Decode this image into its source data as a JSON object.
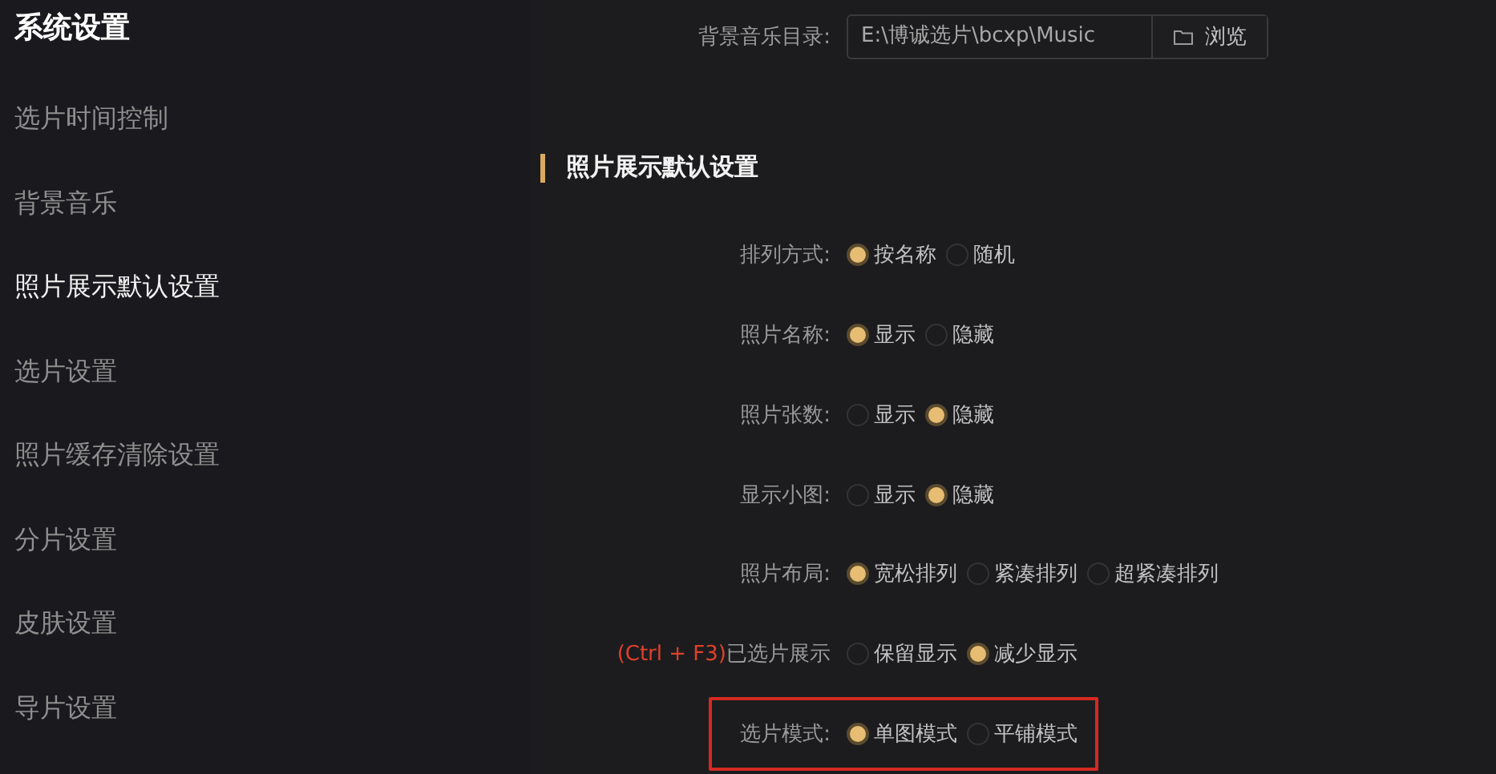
{
  "sidebar": {
    "title": "系统设置",
    "items": [
      {
        "label": "选片时间控制",
        "selected": false
      },
      {
        "label": "背景音乐",
        "selected": false
      },
      {
        "label": "照片展示默认设置",
        "selected": true
      },
      {
        "label": "选片设置",
        "selected": false
      },
      {
        "label": "照片缓存清除设置",
        "selected": false
      },
      {
        "label": "分片设置",
        "selected": false
      },
      {
        "label": "皮肤设置",
        "selected": false
      },
      {
        "label": "导片设置",
        "selected": false
      }
    ]
  },
  "music_dir": {
    "label": "背景音乐目录:",
    "value": "E:\\博诚选片\\bcxp\\Music",
    "button": "浏览"
  },
  "section": {
    "title": "照片展示默认设置",
    "rows": [
      {
        "label": "排列方式:",
        "options": [
          {
            "label": "按名称",
            "selected": true
          },
          {
            "label": "随机",
            "selected": false
          }
        ]
      },
      {
        "label": "照片名称:",
        "options": [
          {
            "label": "显示",
            "selected": true
          },
          {
            "label": "隐藏",
            "selected": false
          }
        ]
      },
      {
        "label": "照片张数:",
        "options": [
          {
            "label": "显示",
            "selected": false
          },
          {
            "label": "隐藏",
            "selected": true
          }
        ]
      },
      {
        "label": "显示小图:",
        "options": [
          {
            "label": "显示",
            "selected": false
          },
          {
            "label": "隐藏",
            "selected": true
          }
        ]
      },
      {
        "label": "照片布局:",
        "options": [
          {
            "label": "宽松排列",
            "selected": true
          },
          {
            "label": "紧凑排列",
            "selected": false
          },
          {
            "label": "超紧凑排列",
            "selected": false
          }
        ]
      },
      {
        "hotkey": "(Ctrl + F3)",
        "label": "已选片展示",
        "options": [
          {
            "label": "保留显示",
            "selected": false
          },
          {
            "label": "减少显示",
            "selected": true
          }
        ]
      },
      {
        "label": "选片模式:",
        "highlighted": true,
        "options": [
          {
            "label": "单图模式",
            "selected": true
          },
          {
            "label": "平铺模式",
            "selected": false
          }
        ]
      }
    ]
  }
}
